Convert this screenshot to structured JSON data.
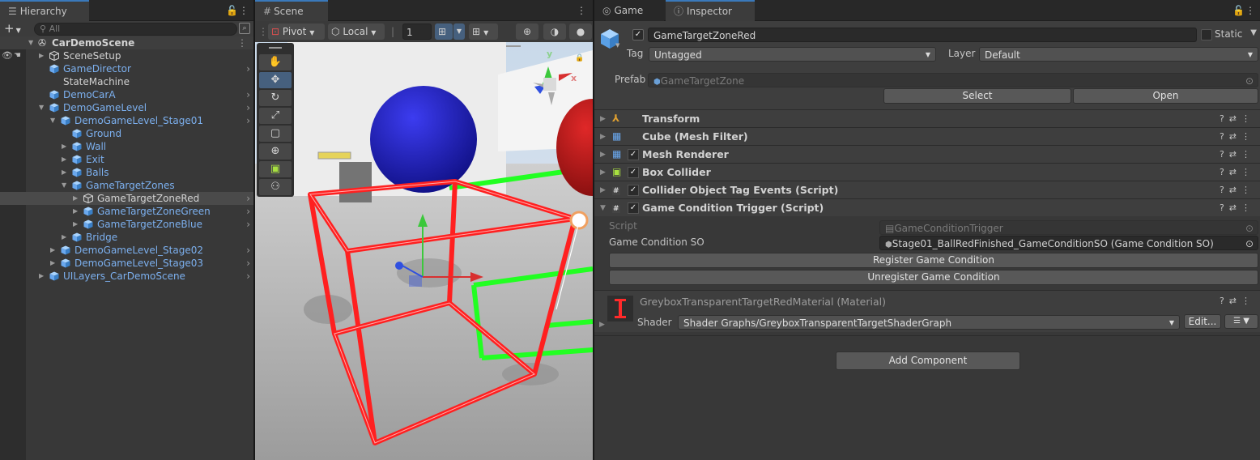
{
  "hierarchy": {
    "tab_label": "Hierarchy",
    "search_placeholder": "All",
    "add_label": "+",
    "scene_name": "CarDemoScene",
    "items": [
      {
        "label": "SceneSetup",
        "blue": false
      },
      {
        "label": "GameDirector",
        "blue": true
      },
      {
        "label": "StateMachine",
        "blue": false
      },
      {
        "label": "DemoCarA",
        "blue": true
      },
      {
        "label": "DemoGameLevel",
        "blue": true
      },
      {
        "label": "DemoGameLevel_Stage01",
        "blue": true
      },
      {
        "label": "Ground",
        "blue": true
      },
      {
        "label": "Wall",
        "blue": true
      },
      {
        "label": "Exit",
        "blue": true
      },
      {
        "label": "Balls",
        "blue": true
      },
      {
        "label": "GameTargetZones",
        "blue": true
      },
      {
        "label": "GameTargetZoneRed",
        "blue": false,
        "selected": true
      },
      {
        "label": "GameTargetZoneGreen",
        "blue": true
      },
      {
        "label": "GameTargetZoneBlue",
        "blue": true
      },
      {
        "label": "Bridge",
        "blue": true
      },
      {
        "label": "DemoGameLevel_Stage02",
        "blue": true
      },
      {
        "label": "DemoGameLevel_Stage03",
        "blue": true
      },
      {
        "label": "UILayers_CarDemoScene",
        "blue": true
      }
    ]
  },
  "scene": {
    "tab_label": "Scene",
    "pivot_label": "Pivot",
    "space_label": "Local",
    "grid_value": "1",
    "gizmo_axes": {
      "y": "y",
      "x": "x"
    }
  },
  "inspector": {
    "game_tab_label": "Game",
    "tab_label": "Inspector",
    "object_name": "GameTargetZoneRed",
    "static_label": "Static",
    "tag_label": "Tag",
    "tag_value": "Untagged",
    "layer_label": "Layer",
    "layer_value": "Default",
    "prefab_label": "Prefab",
    "prefab_value": "GameTargetZone",
    "select_button": "Select",
    "open_button": "Open",
    "components": [
      {
        "name": "Transform",
        "checkbox": false,
        "expanded": false,
        "icon": "transform-icon"
      },
      {
        "name": "Cube (Mesh Filter)",
        "checkbox": false,
        "expanded": false,
        "icon": "mesh-filter-icon"
      },
      {
        "name": "Mesh Renderer",
        "checkbox": true,
        "expanded": false,
        "icon": "mesh-renderer-icon"
      },
      {
        "name": "Box Collider",
        "checkbox": true,
        "expanded": false,
        "icon": "box-collider-icon"
      },
      {
        "name": "Collider Object Tag Events (Script)",
        "checkbox": true,
        "expanded": false,
        "icon": "script-icon"
      },
      {
        "name": "Game Condition Trigger (Script)",
        "checkbox": true,
        "expanded": true,
        "icon": "script-icon"
      }
    ],
    "script_label": "Script",
    "script_value": "GameConditionTrigger",
    "condition_label": "Game Condition SO",
    "condition_value": "Stage01_BallRedFinished_GameConditionSO (Game Condition SO)",
    "register_button": "Register Game Condition",
    "unregister_button": "Unregister Game Condition",
    "material_name": "GreyboxTransparentTargetRedMaterial (Material)",
    "shader_label": "Shader",
    "shader_value": "Shader Graphs/GreyboxTransparentTargetShaderGraph",
    "edit_button": "Edit...",
    "add_component_button": "Add Component"
  },
  "colors": {
    "accent": "#3a79bb",
    "selected_row": "#464646",
    "prefab_blue": "#7cb0ef"
  }
}
